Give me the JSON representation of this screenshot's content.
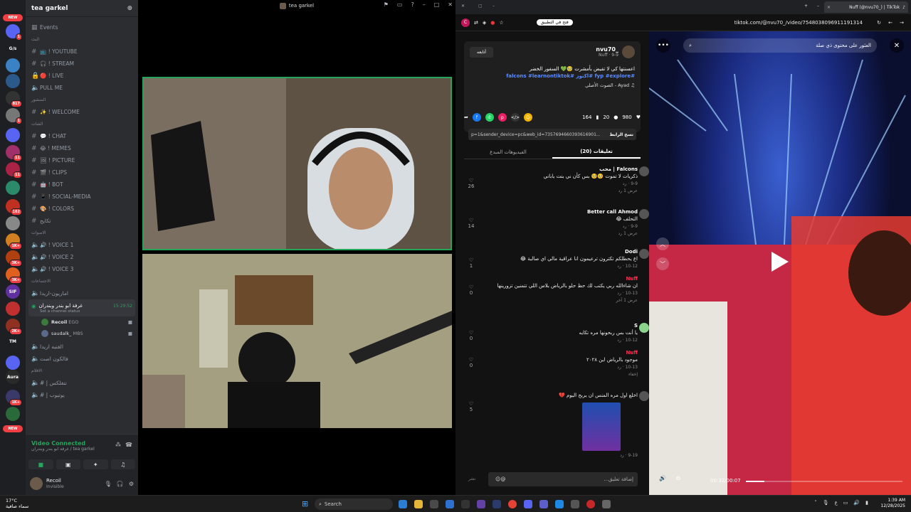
{
  "discord": {
    "rail": {
      "new_label": "NEW",
      "servers": [
        {
          "label": "G/s",
          "badge": ""
        },
        {
          "label": "",
          "badge": "1"
        },
        {
          "label": "",
          "badge": ""
        },
        {
          "label": "",
          "badge": "817"
        },
        {
          "label": "",
          "badge": "1"
        },
        {
          "label": "",
          "badge": "11"
        },
        {
          "label": "",
          "badge": "162"
        },
        {
          "label": "",
          "badge": "1K+"
        },
        {
          "label": "",
          "badge": "3K+"
        },
        {
          "label": "SIF",
          "badge": "4"
        },
        {
          "label": "",
          "badge": "2K+"
        },
        {
          "label": "TM",
          "badge": ""
        },
        {
          "label": "Aura",
          "badge": ""
        },
        {
          "label": "",
          "badge": "1K+"
        }
      ]
    },
    "server_name": "tea garkel",
    "events_label": "Events",
    "categories": {
      "c1": "البث",
      "c2": "المنشور",
      "c3": "الشات",
      "c4": "الاصوات",
      "c5": "الاجتماعات",
      "c6": "الافلام"
    },
    "channels_stream": [
      {
        "icon": "📺",
        "name": "YOUTUBE"
      },
      {
        "icon": "🎧",
        "name": "STREAM"
      },
      {
        "icon": "🔴",
        "name": "LIVE"
      }
    ],
    "pull_me": "PULL ME",
    "welcome": "WELCOME",
    "channels_chat": [
      {
        "icon": "💬",
        "name": "CHAT"
      },
      {
        "icon": "😂",
        "name": "MEMES"
      },
      {
        "icon": "🖼",
        "name": "PICTURE"
      },
      {
        "icon": "🎬",
        "name": "CLIPS"
      },
      {
        "icon": "🤖",
        "name": "BOT"
      },
      {
        "icon": "📱",
        "name": "SOCIAL-MEDIA"
      },
      {
        "icon": "🎨",
        "name": "COLORS"
      }
    ],
    "misc_channel": "تكايح",
    "voice_channels": [
      "VOICE 1",
      "VOICE 2",
      "VOICE 3"
    ],
    "meeting_channels": {
      "m1": "اماريون-اريدا",
      "active": "غرفة ابو بندر وبندران",
      "active_status": "Set a channel status",
      "active_time": "15:29:52",
      "m3": "القنبه اريدا",
      "m4": "فالكون اصت"
    },
    "voice_members": [
      {
        "name": "Recoil",
        "tag": "EGO"
      },
      {
        "name": "saudalk_",
        "tag": "MBS"
      }
    ],
    "film_channels": [
      "# | نتفلكس",
      "# | يوتيوب"
    ],
    "video_connected": "Video Connected",
    "vc_sub": "غرفة ابو بندر وبندران / tea garkel",
    "user": {
      "name": "Recoil",
      "status": "Invisible"
    },
    "window_title": "tea garkel"
  },
  "tiktok": {
    "tab_title": "Nuff (@nvu70_) | TikTok",
    "open_app": "فتح في التطبيق",
    "url": "tiktok.com/@nvu70_/video/7548038096911191314",
    "author": "_nvu70",
    "author_meta": "Nuff · 9-9",
    "follow": "أتابعه",
    "description": "اعسنتها كي لا تفيض بأمشرت 🥹💚 السفور الخضر",
    "tags": "#fyp #explore #اكتوز #falcons #learnontiktok",
    "music": "Ayad - الصوت الأصلي",
    "likes": "980",
    "comments_count": "20",
    "saves": "164",
    "copy_link": "نسخ الرابط",
    "link_text": "p=1&sender_device=pc&web_id=7357694660393616901...",
    "tab_comments": "تعليقات (20)",
    "tab_creator": "الفيديوهات المبدع",
    "comments": [
      {
        "user": "Falcons | محب",
        "text": "ذكريات لا تموت 🥺🥺 بس كأن ني بنت ياباني",
        "meta": "9-9 · رد",
        "likes": "26",
        "replies": "عرض 1 رد"
      },
      {
        "user": "Better call Ahmod",
        "text": "التحلف 😂",
        "meta": "9-9 · رد",
        "likes": "14",
        "replies": "عرض 1 رد"
      },
      {
        "user": "Dodi",
        "text": "اع يحطلكم تكترون ترعيمون انا عراقية مالي اي صالبة 😂",
        "meta": "10-12 · رد",
        "likes": "1",
        "replies": ""
      },
      {
        "user": "Nuff",
        "text": "ان شاءالله ربي يكتب لك حظ حلو بالرياض بلاس اللي تتمنين تزورينها",
        "meta": "10-13 · رد",
        "likes": "0",
        "replies": "عرض 1 آخر"
      },
      {
        "user": "S",
        "text": "يا أنت بس ربحونها مره تكايه",
        "meta": "10-12 · رد",
        "likes": "0",
        "replies": ""
      },
      {
        "user": "Nuff",
        "text": "موجود بالرياض اين ٢٠٢٨",
        "meta": "10-13 · رد",
        "likes": "0",
        "replies": "إخفاء"
      },
      {
        "user": "",
        "text": "اخلع اول مره المنس ان يربح اليوم 💔",
        "meta": "9-19 · رد",
        "likes": "5",
        "replies": ""
      }
    ],
    "comment_placeholder": "إضافة تعليق...",
    "post": "نشر",
    "search_placeholder": "العثور على محتوى ذي صلة",
    "time": "00:32/00:07",
    "progress": 0.12
  },
  "taskbar": {
    "weather_temp": "17°C",
    "weather_desc": "سماء صافية",
    "search": "Search",
    "time": "1:39 AM",
    "date": "12/28/2025",
    "lang": "ع"
  }
}
